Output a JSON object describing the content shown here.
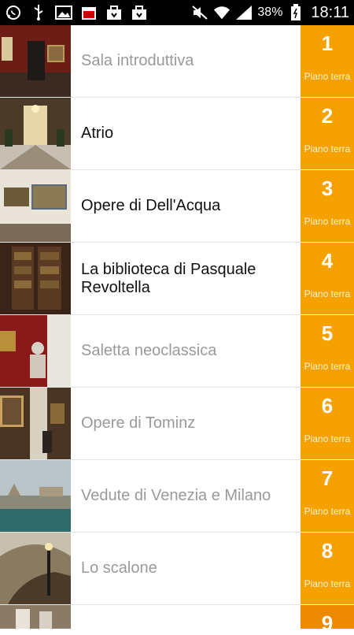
{
  "status_bar": {
    "battery_percent": "38%",
    "time": "18:11",
    "icons_left": [
      "whatsapp-icon",
      "usb-icon",
      "image-icon",
      "calendar-icon",
      "bag-icon",
      "bag-icon"
    ],
    "icons_right": [
      "mute-icon",
      "wifi-icon",
      "signal-icon",
      "battery-icon"
    ]
  },
  "rooms": [
    {
      "number": "1",
      "title": "Sala introduttiva",
      "floor": "Piano terra",
      "state": "visited"
    },
    {
      "number": "2",
      "title": "Atrio",
      "floor": "Piano terra",
      "state": "active"
    },
    {
      "number": "3",
      "title": "Opere di Dell'Acqua",
      "floor": "Piano terra",
      "state": "active"
    },
    {
      "number": "4",
      "title": "La biblioteca di Pasquale Revoltella",
      "floor": "Piano terra",
      "state": "active"
    },
    {
      "number": "5",
      "title": "Saletta neoclassica",
      "floor": "Piano terra",
      "state": "visited"
    },
    {
      "number": "6",
      "title": "Opere di Tominz",
      "floor": "Piano terra",
      "state": "visited"
    },
    {
      "number": "7",
      "title": "Vedute di Venezia e Milano",
      "floor": "Piano terra",
      "state": "visited"
    },
    {
      "number": "8",
      "title": "Lo scalone",
      "floor": "Piano terra",
      "state": "visited"
    },
    {
      "number": "9",
      "title": "",
      "floor": "",
      "state": "visited"
    }
  ],
  "colors": {
    "badge_orange": "#f5a200",
    "visited_text": "#9a9a9a",
    "active_text": "#111111"
  }
}
